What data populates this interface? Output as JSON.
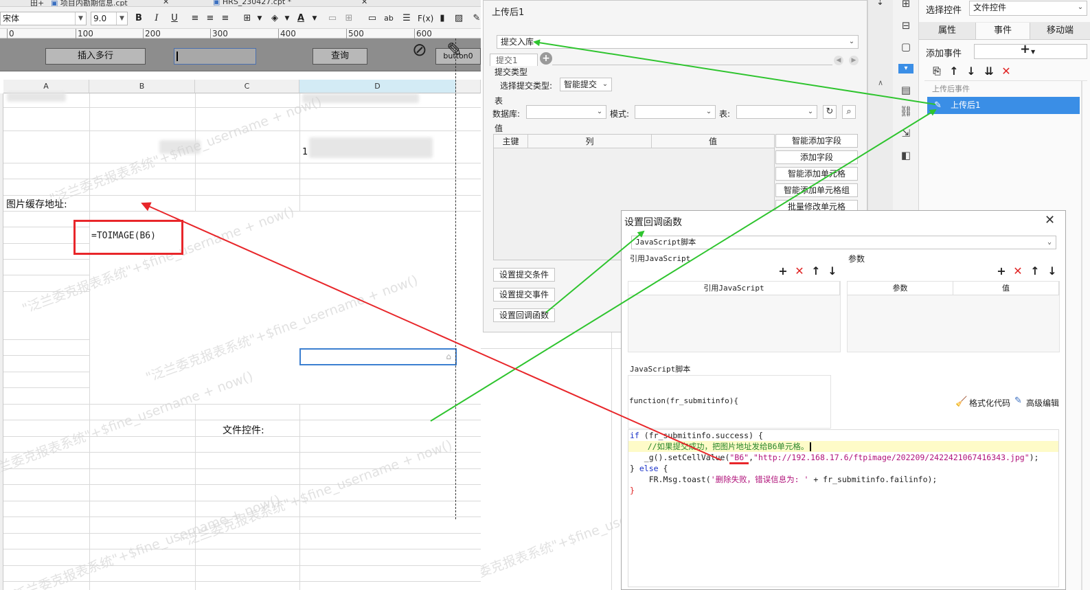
{
  "file_tabs": [
    {
      "label": "田+"
    },
    {
      "label": "项目内勘期信息.cpt"
    },
    {
      "label": "HRS_230427.cpt *"
    }
  ],
  "toolbar": {
    "font_name": "宋体",
    "font_size": "9.0",
    "bold": "B",
    "italic": "I",
    "underline": "U",
    "fx": "F(x)",
    "ab": "ab"
  },
  "ruler": {
    "ticks": [
      "0",
      "100",
      "200",
      "300",
      "400",
      "500",
      "600"
    ]
  },
  "param_pane": {
    "insert_rows_button": "插入多行",
    "query_button": "查询",
    "button0": "button0"
  },
  "sheet": {
    "columns": [
      "A",
      "B",
      "C",
      "D"
    ],
    "image_cache_label": "图片缓存地址:",
    "formula": "=TOIMAGE(B6)",
    "file_control_label": "文件控件:",
    "partial_text": "1"
  },
  "watermark": "\"泛兰委克报表系统\"+$fine_username + now()",
  "submit_panel": {
    "title": "上传后1",
    "submit_type_select": "提交入库",
    "tab": "提交1",
    "submit_type_header": "提交类型",
    "choose_type_label": "选择提交类型:",
    "choose_type_value": "智能提交",
    "table_header": "表",
    "db_label": "数据库:",
    "schema_label": "模式:",
    "table_label": "表:",
    "value_header": "值",
    "grid_headers": [
      "主键",
      "列",
      "值"
    ],
    "side_buttons": [
      "智能添加字段",
      "添加字段",
      "智能添加单元格",
      "智能添加单元格组",
      "批量修改单元格"
    ],
    "bottom_buttons": [
      "设置提交条件",
      "设置提交事件",
      "设置回调函数"
    ]
  },
  "props": {
    "select_control_label": "选择控件",
    "select_control_value": "文件控件",
    "tabs": [
      "属性",
      "事件",
      "移动端"
    ],
    "add_event_label": "添加事件",
    "after_upload_header": "上传后事件",
    "event_item": "上传后1"
  },
  "dialog": {
    "title": "设置回调函数",
    "type_select": "JavaScript脚本",
    "ref_js_label": "引用JavaScript",
    "params_label": "参数",
    "ref_js_col": "引用JavaScript",
    "params_cols": [
      "参数",
      "值"
    ],
    "js_script_label": "JavaScript脚本",
    "function_sig": "function(fr_submitinfo){",
    "format_code": "格式化代码",
    "advanced_edit": "高级编辑",
    "code": {
      "l1a": "if",
      "l1b": " (fr_submitinfo.success) {",
      "l2": "    //如果提交成功，把图片地址发给B6单元格。",
      "l3a": "   _g().setCellValue(",
      "l3b": "\"B6\"",
      "l3c": ",",
      "l3d": "\"http://192.168.17.6/ftpimage/202209/2422421067416343.jpg\"",
      "l3e": ");",
      "l4a": "} ",
      "l4b": "else",
      "l4c": " {",
      "l5a": "    FR.Msg.toast(",
      "l5b": "'删除失败，错误信息为: '",
      "l5c": " + fr_submitinfo.failinfo);",
      "l6": "}"
    }
  },
  "colors": {
    "red_annot": "#e8262a",
    "green_annot": "#2ec42e",
    "selection_blue": "#3b7fd0",
    "event_item_bg": "#3a8ee6"
  }
}
